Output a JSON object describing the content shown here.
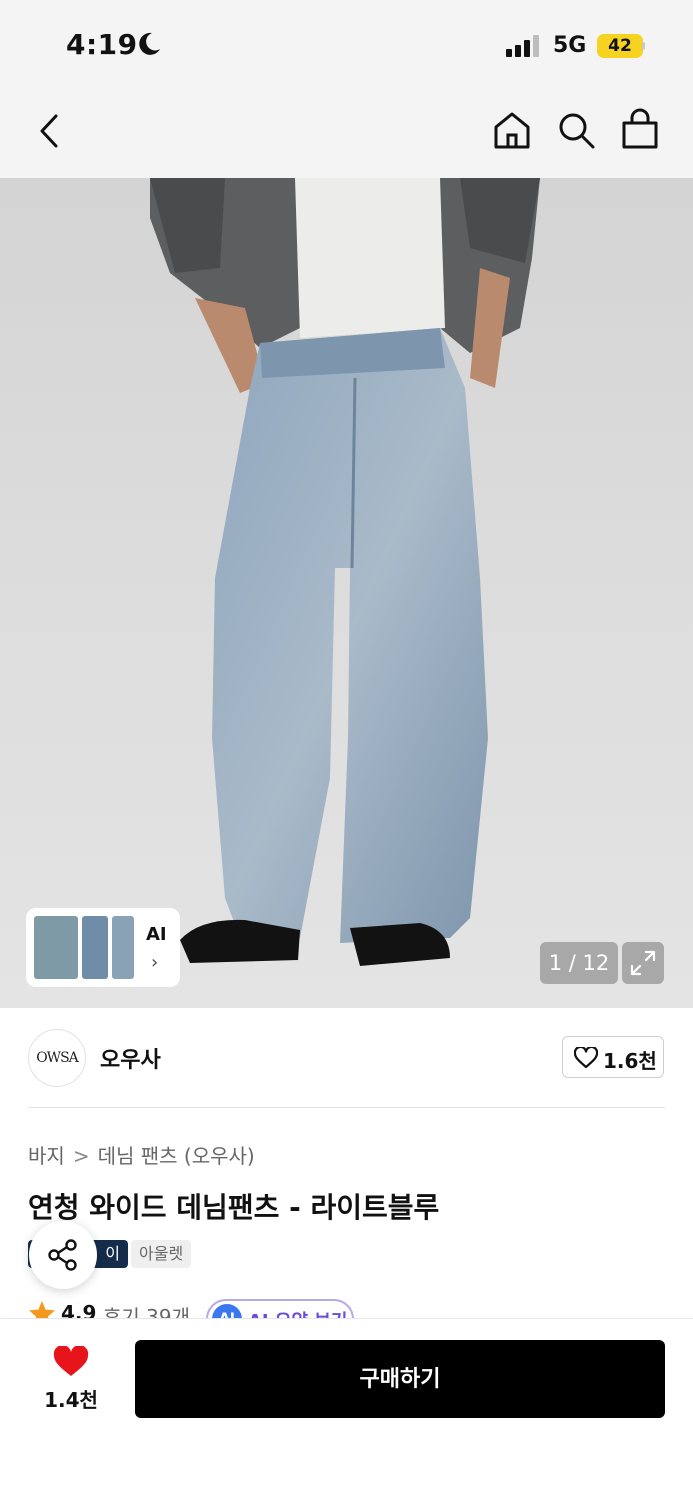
{
  "status_bar": {
    "time": "4:19",
    "network": "5G",
    "battery": "42",
    "battery_color": "#f5d320"
  },
  "nav": {
    "back_icon": "chevron-left-icon",
    "home_icon": "home-icon",
    "search_icon": "search-icon",
    "cart_icon": "shopping-bag-icon"
  },
  "gallery": {
    "ai_label": "AI",
    "ai_arrow": "›",
    "counter": "1 / 12",
    "current_image": 1,
    "total_images": 12
  },
  "brand": {
    "logo_text": "OWSA",
    "name": "오우사",
    "like_count": "1.6천"
  },
  "product": {
    "breadcrumb": [
      "바지",
      "데님 팬츠 (오우사)"
    ],
    "breadcrumb_separator": ">",
    "title": "연청 와이드 데님팬츠 - 라이트블루",
    "tags": [
      "이",
      "아울렛"
    ],
    "rating": "4.9",
    "reviews": "후기 39개",
    "ai_summary_badge": "AI",
    "ai_summary_label": "AI 요약 보기",
    "accent_color": "#152c4a",
    "star_color": "#f39a1e"
  },
  "bottom": {
    "wish_count": "1.4천",
    "buy_label": "구매하기",
    "heart_color": "#e8141c"
  }
}
